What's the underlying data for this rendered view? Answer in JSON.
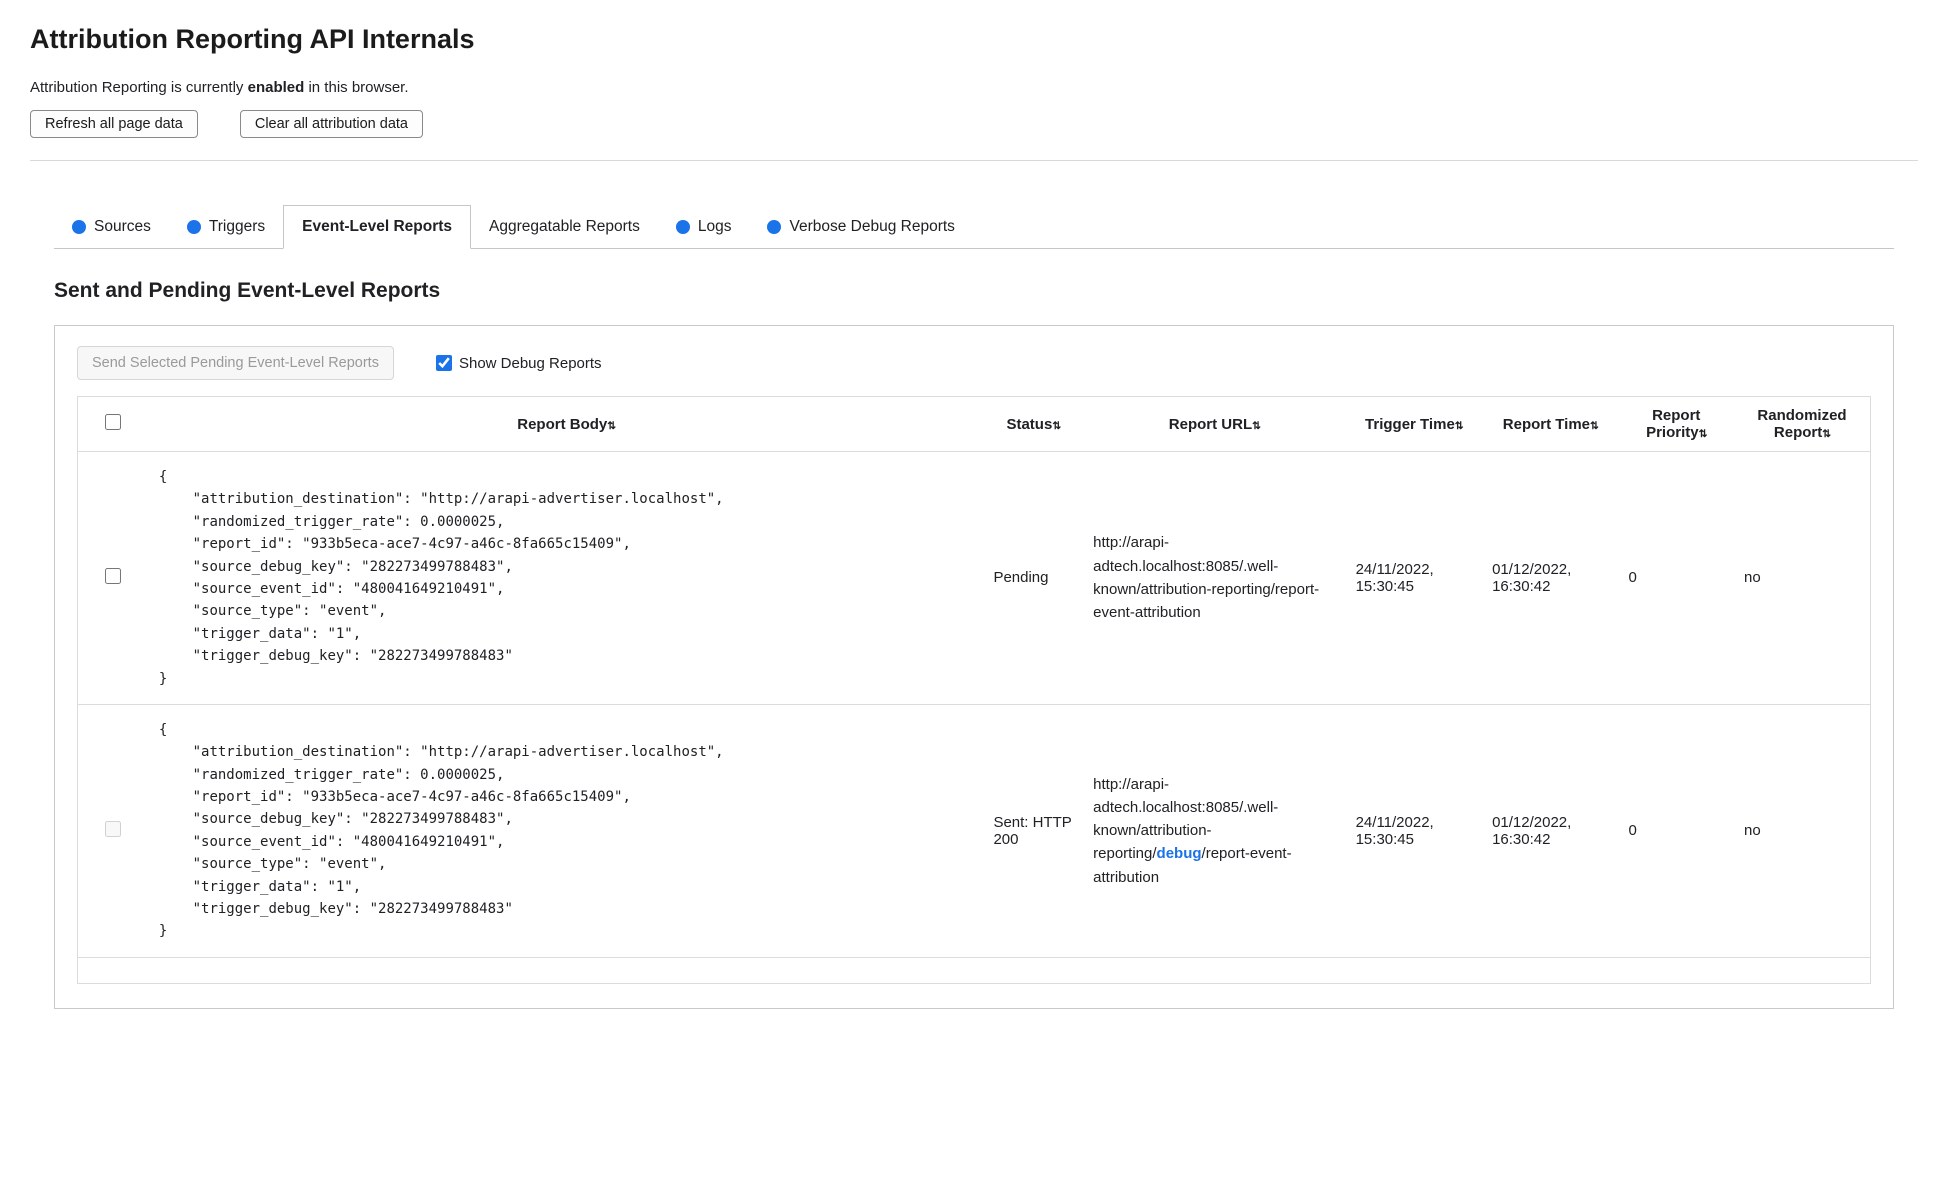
{
  "page": {
    "title": "Attribution Reporting API Internals",
    "status_prefix": "Attribution Reporting is currently ",
    "status_bold": "enabled",
    "status_suffix": " in this browser.",
    "refresh_button": "Refresh all page data",
    "clear_button": "Clear all attribution data"
  },
  "tabs": [
    {
      "label": "Sources",
      "dot": true,
      "active": false
    },
    {
      "label": "Triggers",
      "dot": true,
      "active": false
    },
    {
      "label": "Event-Level Reports",
      "dot": false,
      "active": true
    },
    {
      "label": "Aggregatable Reports",
      "dot": false,
      "active": false
    },
    {
      "label": "Logs",
      "dot": true,
      "active": false
    },
    {
      "label": "Verbose Debug Reports",
      "dot": true,
      "active": false
    }
  ],
  "section": {
    "heading": "Sent and Pending Event-Level Reports",
    "send_button": "Send Selected Pending Event-Level Reports",
    "show_debug_label": "Show Debug Reports",
    "show_debug_checked": true
  },
  "table": {
    "sort_icon": "⇅",
    "headers": [
      "Report Body",
      "Status",
      "Report URL",
      "Trigger Time",
      "Report Time",
      "Report Priority",
      "Randomized Report"
    ],
    "rows": [
      {
        "body": "{\n    \"attribution_destination\": \"http://arapi-advertiser.localhost\",\n    \"randomized_trigger_rate\": 0.0000025,\n    \"report_id\": \"933b5eca-ace7-4c97-a46c-8fa665c15409\",\n    \"source_debug_key\": \"282273499788483\",\n    \"source_event_id\": \"480041649210491\",\n    \"source_type\": \"event\",\n    \"trigger_data\": \"1\",\n    \"trigger_debug_key\": \"282273499788483\"\n}",
        "status": "Pending",
        "url_prefix": "http://arapi-adtech.localhost:8085/.well-known/attribution-reporting/report-event-attribution",
        "url_link": "",
        "url_suffix": "",
        "trigger_time": "24/11/2022, 15:30:45",
        "report_time": "01/12/2022, 16:30:42",
        "priority": "0",
        "randomized": "no"
      },
      {
        "body": "{\n    \"attribution_destination\": \"http://arapi-advertiser.localhost\",\n    \"randomized_trigger_rate\": 0.0000025,\n    \"report_id\": \"933b5eca-ace7-4c97-a46c-8fa665c15409\",\n    \"source_debug_key\": \"282273499788483\",\n    \"source_event_id\": \"480041649210491\",\n    \"source_type\": \"event\",\n    \"trigger_data\": \"1\",\n    \"trigger_debug_key\": \"282273499788483\"\n}",
        "status": "Sent: HTTP 200",
        "url_prefix": "http://arapi-adtech.localhost:8085/.well-known/attribution-reporting/",
        "url_link": "debug",
        "url_suffix": "/report-event-attribution",
        "trigger_time": "24/11/2022, 15:30:45",
        "report_time": "01/12/2022, 16:30:42",
        "priority": "0",
        "randomized": "no"
      }
    ]
  }
}
